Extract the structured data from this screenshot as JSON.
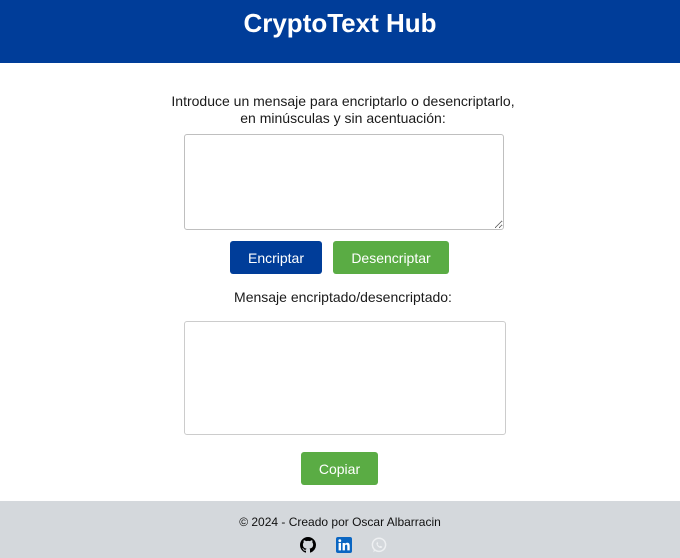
{
  "header": {
    "title": "CryptoText Hub"
  },
  "main": {
    "instruction": "Introduce un mensaje para encriptarlo o desencriptarlo, en minúsculas y sin acentuación:",
    "input_value": "",
    "encrypt_label": "Encriptar",
    "decrypt_label": "Desencriptar",
    "result_label": "Mensaje encriptado/desencriptado:",
    "output_value": "",
    "copy_label": "Copiar"
  },
  "footer": {
    "copyright": "© 2024 - Creado por Oscar Albarracin",
    "social": [
      {
        "icon": "github-icon",
        "color": "#000000"
      },
      {
        "icon": "linkedin-icon",
        "color": "#0a66c2"
      },
      {
        "icon": "whatsapp-icon",
        "color": "#c8ccd0"
      }
    ]
  },
  "colors": {
    "header_bg": "#003d99",
    "primary_button": "#003d99",
    "secondary_button": "#5aac44",
    "footer_bg": "#d4d8dc"
  }
}
